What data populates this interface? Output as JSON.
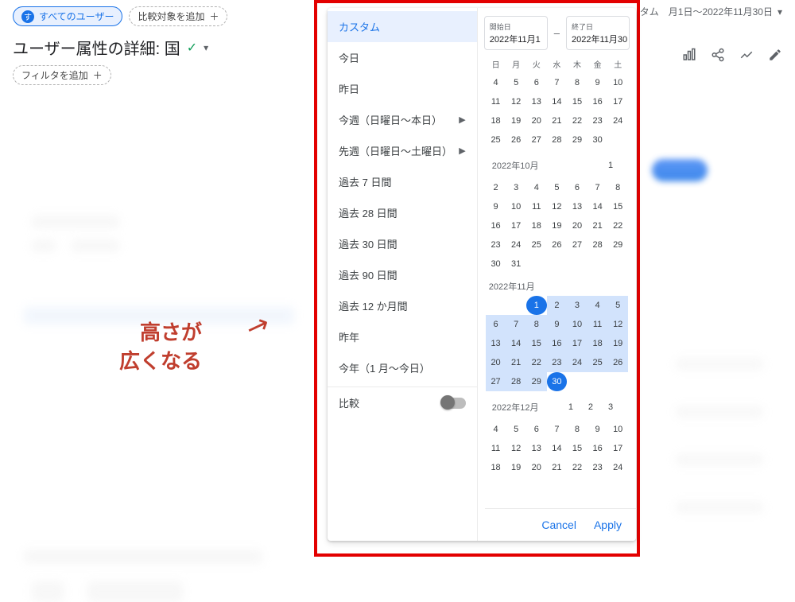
{
  "header": {
    "chip_all_users": "すべてのユーザー",
    "chip_add_compare": "比較対象を追加",
    "chip_icon_letter": "す",
    "page_title": "ユーザー属性の詳細: 国",
    "chip_add_filter": "フィルタを追加",
    "date_summary_prefix": "タム",
    "date_summary": "月1日～2022年11月30日"
  },
  "annotation": {
    "line1": "高さが",
    "line2": "広くなる",
    "arrow": "↗"
  },
  "panel": {
    "presets": [
      {
        "label": "カスタム",
        "selected": true
      },
      {
        "label": "今日"
      },
      {
        "label": "昨日"
      },
      {
        "label": "今週（日曜日～本日）",
        "caret": true
      },
      {
        "label": "先週（日曜日～土曜日）",
        "caret": true
      },
      {
        "label": "過去 7 日間"
      },
      {
        "label": "過去 28 日間"
      },
      {
        "label": "過去 30 日間"
      },
      {
        "label": "過去 90 日間"
      },
      {
        "label": "過去 12 か月間"
      },
      {
        "label": "昨年"
      },
      {
        "label": "今年（1 月～今日）"
      }
    ],
    "compare_label": "比較",
    "start_label": "開始日",
    "end_label": "終了日",
    "start_value": "2022年11月1",
    "end_value": "2022年11月30",
    "dow": [
      "日",
      "月",
      "火",
      "水",
      "木",
      "金",
      "土"
    ],
    "cancel": "Cancel",
    "apply": "Apply",
    "months": {
      "sep_trail_header_day": "",
      "oct": {
        "label": "2022年10月",
        "trail_day": "1"
      },
      "nov": {
        "label": "2022年11月"
      },
      "dec": {
        "label": "2022年12月",
        "trail_days": [
          "1",
          "2",
          "3"
        ]
      }
    }
  },
  "calendar": {
    "sep_rows": [
      [
        "4",
        "5",
        "6",
        "7",
        "8",
        "9",
        "10"
      ],
      [
        "11",
        "12",
        "13",
        "14",
        "15",
        "16",
        "17"
      ],
      [
        "18",
        "19",
        "20",
        "21",
        "22",
        "23",
        "24"
      ],
      [
        "25",
        "26",
        "27",
        "28",
        "29",
        "30",
        ""
      ]
    ],
    "oct_rows": [
      [
        "2",
        "3",
        "4",
        "5",
        "6",
        "7",
        "8"
      ],
      [
        "9",
        "10",
        "11",
        "12",
        "13",
        "14",
        "15"
      ],
      [
        "16",
        "17",
        "18",
        "19",
        "20",
        "21",
        "22"
      ],
      [
        "23",
        "24",
        "25",
        "26",
        "27",
        "28",
        "29"
      ],
      [
        "30",
        "31",
        "",
        "",
        "",
        "",
        ""
      ]
    ],
    "nov_rows": [
      [
        "",
        "",
        "1",
        "2",
        "3",
        "4",
        "5"
      ],
      [
        "6",
        "7",
        "8",
        "9",
        "10",
        "11",
        "12"
      ],
      [
        "13",
        "14",
        "15",
        "16",
        "17",
        "18",
        "19"
      ],
      [
        "20",
        "21",
        "22",
        "23",
        "24",
        "25",
        "26"
      ],
      [
        "27",
        "28",
        "29",
        "30",
        "",
        "",
        ""
      ]
    ],
    "nov_range_start": 1,
    "nov_range_end": 30,
    "dec_rows": [
      [
        "4",
        "5",
        "6",
        "7",
        "8",
        "9",
        "10"
      ],
      [
        "11",
        "12",
        "13",
        "14",
        "15",
        "16",
        "17"
      ],
      [
        "18",
        "19",
        "20",
        "21",
        "22",
        "23",
        "24"
      ]
    ]
  }
}
